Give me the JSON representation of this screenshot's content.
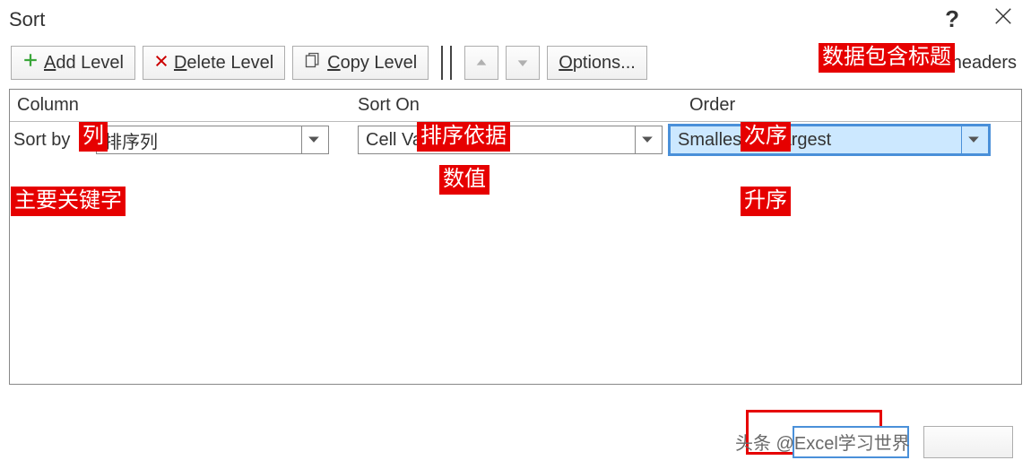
{
  "title": "Sort",
  "toolbar": {
    "add": "Add Level",
    "delete": "Delete Level",
    "copy": "Copy Level",
    "options": "Options...",
    "headers": "My data has headers"
  },
  "grid": {
    "col_column": "Column",
    "col_sorton": "Sort On",
    "col_order": "Order",
    "row_label": "Sort by",
    "row_column_value": "排序列",
    "row_sorton_value": "Cell Values",
    "row_order_value": "Smallest to Largest"
  },
  "annotations": {
    "headers_cn": "数据包含标题",
    "column_cn": "列",
    "sorton_cn": "排序依据",
    "order_cn": "次序",
    "sortby_cn": "主要关键字",
    "cellvalues_cn": "数值",
    "order_value_cn": "升序"
  },
  "watermark": "头条 @Excel学习世界"
}
